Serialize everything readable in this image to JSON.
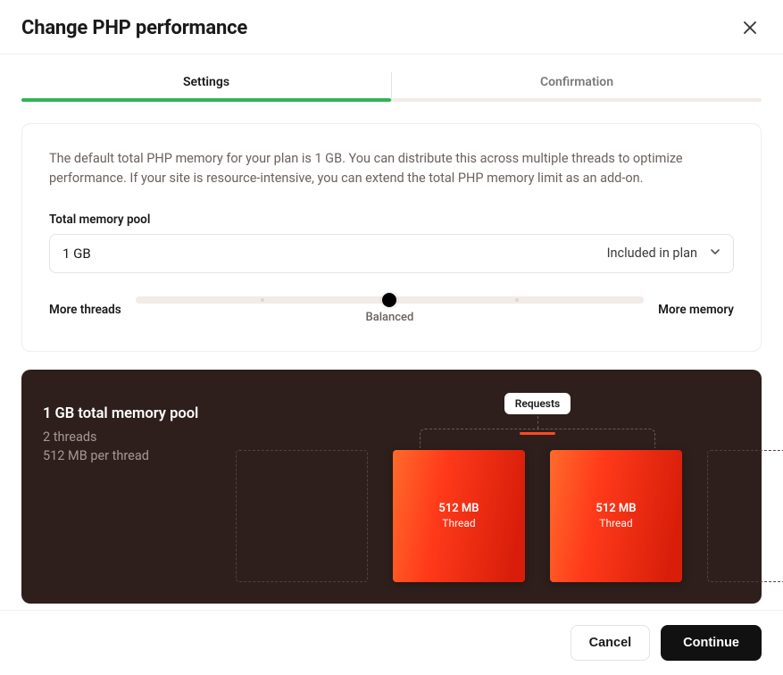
{
  "header": {
    "title": "Change PHP performance"
  },
  "stepper": {
    "steps": [
      {
        "label": "Settings",
        "active": true
      },
      {
        "label": "Confirmation",
        "active": false
      }
    ]
  },
  "settings": {
    "description": "The default total PHP memory for your plan is 1 GB. You can distribute this across multiple threads to optimize performance. If your site is resource-intensive, you can extend the total PHP memory limit as an add-on.",
    "memory_pool_label": "Total memory pool",
    "memory_pool_value": "1 GB",
    "memory_pool_badge": "Included in plan",
    "slider": {
      "left_label": "More threads",
      "right_label": "More memory",
      "caption": "Balanced",
      "position_pct": 50,
      "ticks_pct": [
        25,
        50,
        75
      ]
    }
  },
  "preview": {
    "title": "1 GB total memory pool",
    "threads_line": "2 threads",
    "per_thread_line": "512 MB per thread",
    "requests_label": "Requests",
    "thread_size": "512 MB",
    "thread_label": "Thread"
  },
  "footer": {
    "cancel": "Cancel",
    "continue": "Continue"
  },
  "colors": {
    "accent_green": "#2fb457",
    "accent_orange": "#ff3a1a",
    "dark_bg": "#2e1f1c"
  }
}
